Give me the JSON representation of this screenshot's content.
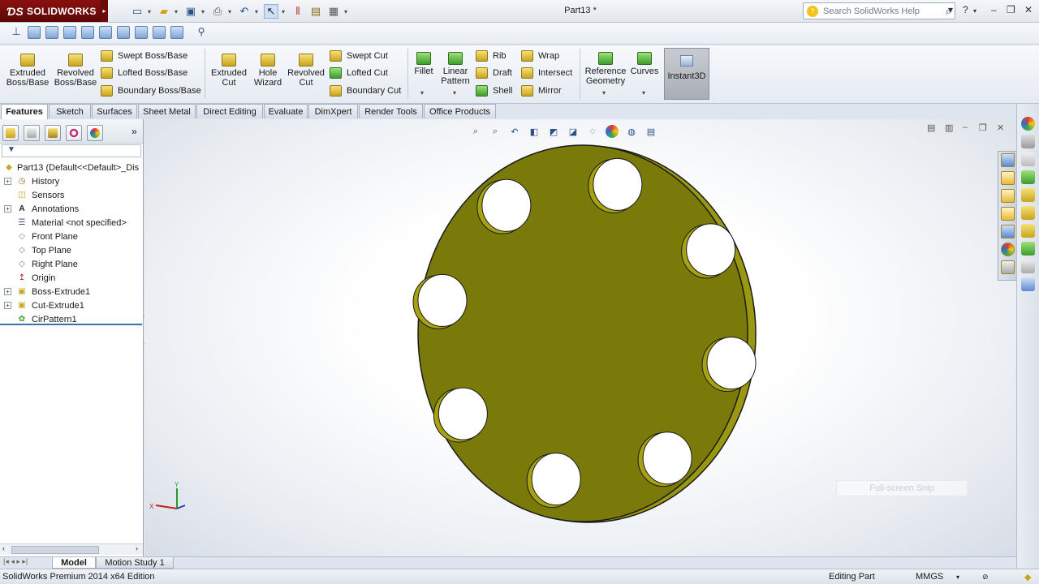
{
  "app": {
    "brand": "SOLIDWORKS",
    "document_title": "Part13 *",
    "search_placeholder": "Search SolidWorks Help"
  },
  "command_manager": {
    "extruded_boss": "Extruded Boss/Base",
    "revolved_boss": "Revolved Boss/Base",
    "swept_boss": "Swept Boss/Base",
    "lofted_boss": "Lofted Boss/Base",
    "boundary_boss": "Boundary Boss/Base",
    "extruded_cut": "Extruded Cut",
    "hole_wizard": "Hole Wizard",
    "revolved_cut": "Revolved Cut",
    "swept_cut": "Swept Cut",
    "lofted_cut": "Lofted Cut",
    "boundary_cut": "Boundary Cut",
    "fillet": "Fillet",
    "linear_pattern": "Linear Pattern",
    "rib": "Rib",
    "draft": "Draft",
    "shell": "Shell",
    "wrap": "Wrap",
    "intersect": "Intersect",
    "mirror": "Mirror",
    "reference_geometry": "Reference Geometry",
    "curves": "Curves",
    "instant3d": "Instant3D"
  },
  "tabs": [
    "Features",
    "Sketch",
    "Surfaces",
    "Sheet Metal",
    "Direct Editing",
    "Evaluate",
    "DimXpert",
    "Render Tools",
    "Office Products"
  ],
  "tree": {
    "root": "Part13  (Default<<Default>_Dis",
    "items": [
      "History",
      "Sensors",
      "Annotations",
      "Material <not specified>",
      "Front Plane",
      "Top Plane",
      "Right Plane",
      "Origin",
      "Boss-Extrude1",
      "Cut-Extrude1",
      "CirPattern1"
    ]
  },
  "graphics": {
    "part_color": "#7a7a0a",
    "hole_count": 8,
    "snip_label": "Full-screen Snip"
  },
  "bottom_tabs": [
    "Model",
    "Motion Study 1"
  ],
  "status": {
    "edition": "SolidWorks Premium 2014 x64 Edition",
    "mode": "Editing Part",
    "units": "MMGS"
  }
}
